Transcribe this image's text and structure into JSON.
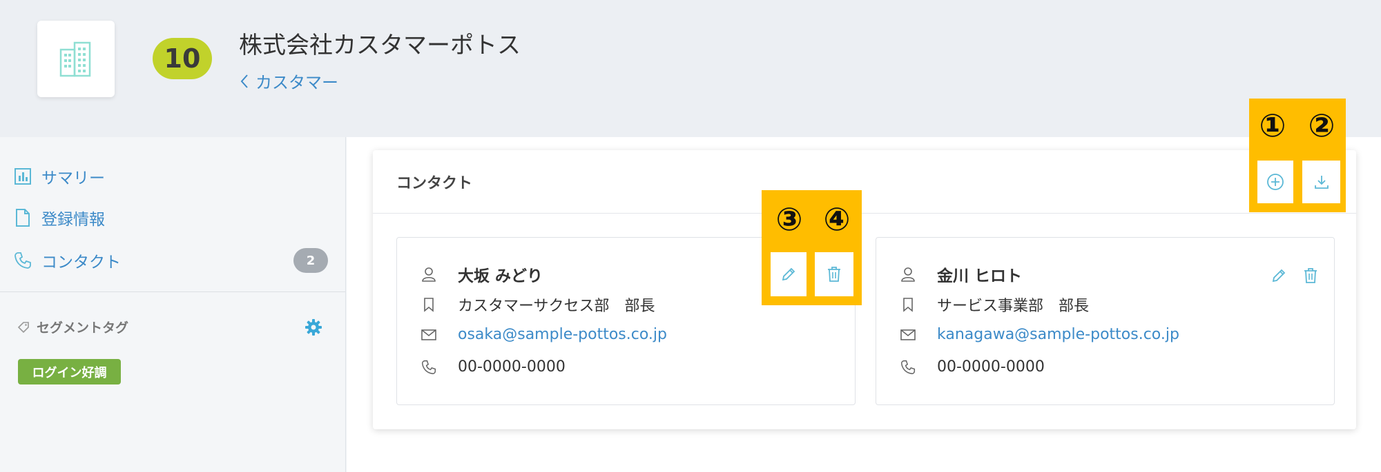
{
  "header": {
    "id_number": "10",
    "company_name": "株式会社カスタマーポトス",
    "breadcrumb": "カスタマー"
  },
  "sidebar": {
    "items": [
      {
        "label": "サマリー",
        "icon": "bar-chart-icon"
      },
      {
        "label": "登録情報",
        "icon": "document-icon"
      },
      {
        "label": "コンタクト",
        "icon": "phone-icon",
        "count": "2"
      }
    ],
    "segment_title": "セグメントタグ",
    "segment_tag": "ログイン好調"
  },
  "panel": {
    "title": "コンタクト"
  },
  "contacts": [
    {
      "name": "大坂 みどり",
      "position": "カスタマーサクセス部　部長",
      "email": "osaka@sample-pottos.co.jp",
      "phone": "00-0000-0000"
    },
    {
      "name": "金川 ヒロト",
      "position": "サービス事業部　部長",
      "email": "kanagawa@sample-pottos.co.jp",
      "phone": "00-0000-0000"
    }
  ],
  "annotations": [
    "①",
    "②",
    "③",
    "④"
  ],
  "colors": {
    "accent": "#3c8ac8",
    "badge": "#c1d22b",
    "tag": "#78b042",
    "highlight": "#ffbd00",
    "icon": "#5bb8d6"
  }
}
